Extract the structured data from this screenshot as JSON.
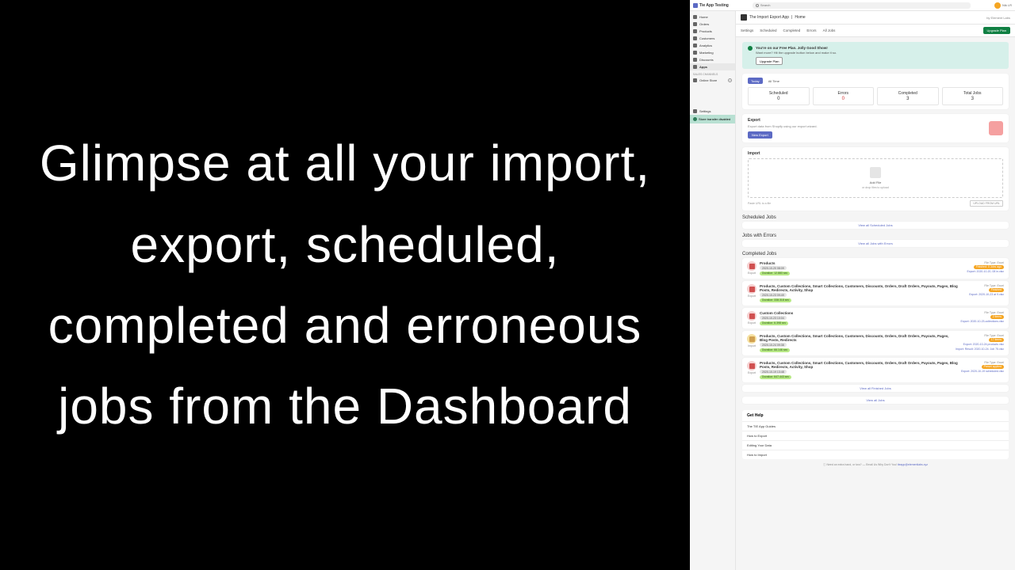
{
  "hero": "Glimpse at all your import, export, scheduled, completed and erroneous jobs from the Dashboard",
  "header": {
    "store": "Tie App Testing",
    "search_placeholder": "Search",
    "user": "Nik LR"
  },
  "sidebar": {
    "items": [
      {
        "label": "Home"
      },
      {
        "label": "Orders"
      },
      {
        "label": "Products"
      },
      {
        "label": "Customers"
      },
      {
        "label": "Analytics"
      },
      {
        "label": "Marketing"
      },
      {
        "label": "Discounts"
      },
      {
        "label": "Apps"
      }
    ],
    "channels_label": "SALES CHANNELS",
    "channels": [
      {
        "label": "Online Store"
      }
    ],
    "settings": "Settings",
    "transfer": "Store transfer disabled"
  },
  "breadcrumb": {
    "app": "The Import Export App",
    "page": "Home",
    "by": "by Element Labs"
  },
  "tabs": [
    "Settings",
    "Scheduled",
    "Completed",
    "Errors",
    "All Jobs"
  ],
  "upgrade": "Upgrade Plan",
  "notice": {
    "title": "You're on our Free Plan. Jolly Good Show!",
    "text": "Want more? Hit the upgrade button below and make it so.",
    "btn": "Upgrade Plan"
  },
  "period": {
    "today": "Today",
    "all": "All Time"
  },
  "stats": [
    {
      "label": "Scheduled",
      "value": "0"
    },
    {
      "label": "Errors",
      "value": "0"
    },
    {
      "label": "Completed",
      "value": "3"
    },
    {
      "label": "Total Jobs",
      "value": "3"
    }
  ],
  "export": {
    "title": "Export",
    "sub": "Export data from Shopify using our export wizard.",
    "btn": "New Export"
  },
  "import": {
    "title": "Import",
    "add": "Add File",
    "drag": "or drop files to upload",
    "url_placeholder": "Paste URL to a file",
    "upload_btn": "UPLOAD FROM URL"
  },
  "sections": {
    "scheduled": "Scheduled Jobs",
    "scheduled_link": "View all Scheduled Jobs",
    "errors": "Jobs with Errors",
    "errors_link": "View all Jobs with Errors",
    "completed": "Completed Jobs",
    "completed_link": "View all Finished Jobs",
    "all_link": "View all Jobs"
  },
  "jobs": [
    {
      "kind": "Export",
      "title": "Products",
      "date": "2020-10-20 08:09",
      "duration": "Duration: 12.883 sec",
      "filetype": "File Type: Excel",
      "status": "Finished: 0 Jobs ago",
      "items": "",
      "link": "Export: 2020-10-20, 08 in.xlsx"
    },
    {
      "kind": "Export",
      "title": "Products, Custom Collections, Smart Collections, Customers, Discounts, Orders, Draft Orders, Payouts, Pages, Blog Posts, Redirects, Activity, Shop",
      "date": "2020-10-23 09:49",
      "duration": "Duration: 338.318 sec",
      "filetype": "File Type: Excel",
      "status": "Finished",
      "items": "",
      "link": "Export: 2020-10-23 at 9.xlsx"
    },
    {
      "kind": "Export",
      "title": "Custom Collections",
      "date": "2020-10-23 10:04",
      "duration": "Duration: 6.398 sec",
      "filetype": "File Type: Excel",
      "status": "2 items",
      "items": "",
      "link": "Export: 2020-10-23-collections.xlsx"
    },
    {
      "kind": "Import",
      "title": "Products, Custom Collections, Smart Collections, Customers, Discounts, Orders, Draft Orders, Payouts, Pages, Blog Posts, Redirects",
      "date": "2020-10-24 09:38",
      "duration": "Duration: 66.146 sec",
      "filetype": "File Type: Excel",
      "status": "17 items",
      "items": "Export: 2020-10-24 products xlsx",
      "link": "Import: Result: 2020-10-24. Job 75.xlsx"
    },
    {
      "kind": "Export",
      "title": "Products, Custom Collections, Smart Collections, Customers, Discounts, Orders, Draft Orders, Payouts, Pages, Blog Posts, Redirects, Activity, Shop",
      "date": "2020-10-19 13:48",
      "duration": "Duration: 647.443 sec",
      "filetype": "File Type: Excel",
      "status": "Preset applied",
      "items": "",
      "link": "Export: 2020-10-19 scheduled.xlsx"
    }
  ],
  "help": {
    "title": "Get Help",
    "items": [
      "The TIE App Guides",
      "How to Export",
      "Editing Your Data",
      "How to Import"
    ]
  },
  "footer": {
    "text": "Need an extra hand, or two?",
    "email_label": "Email Us Why Don't You!",
    "email": "tieapp@elementlabs.xyz"
  }
}
